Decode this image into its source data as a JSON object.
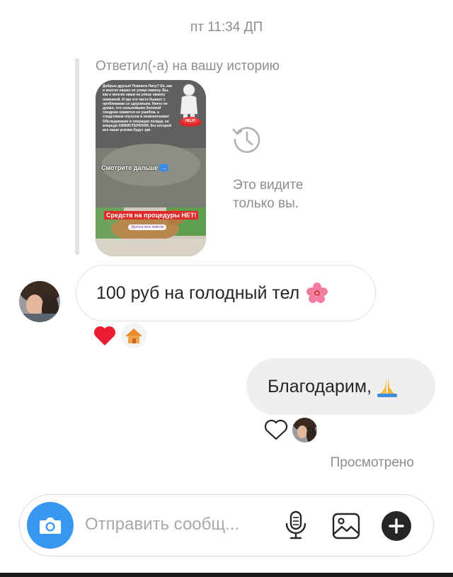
{
  "thread": {
    "timestamp": "пт 11:34 ДП"
  },
  "story_reply": {
    "label": "Ответил(-а) на вашу историю",
    "only_you_line1": "Это видите",
    "only_you_line2": "только вы.",
    "story_text": "Добрые друзья! Помните Лису? Её, как и многих наших не улице нажоху. Вы, как и многие наши на улице нажоху ноженной. И как это часто бывает с проблемами со здоровьем. Никто не думал, что сильнейшим болевой синдром окажется не ушибом, а следствием опухоли в позвоночнике! Обследование и операция позади, но впереди ХИМИОТЕРАПИЯ, без которой все наши усилия будут зря",
    "story_badge": "HELP!",
    "story_caption_1": "Смотрите дальше",
    "story_caption_arrow": "→",
    "story_caption_2": "Средств на процедуры НЕТ!",
    "story_handle": "@priyut.dom.dobroty"
  },
  "messages": {
    "incoming_text": "100 руб на голодный тел",
    "outgoing_text": "Благодарим,"
  },
  "status": {
    "seen": "Просмотрено"
  },
  "composer": {
    "placeholder": "Отправить сообщ..."
  },
  "colors": {
    "accent_blue": "#3897f0",
    "reaction_red": "#ed1c32",
    "outgoing_bubble": "#efefef",
    "muted_text": "#8e8e8e"
  },
  "icons": {
    "history": "history-icon",
    "heart": "heart-icon",
    "camera": "camera-icon",
    "mic": "microphone-icon",
    "gallery": "gallery-icon",
    "plus": "plus-icon"
  }
}
